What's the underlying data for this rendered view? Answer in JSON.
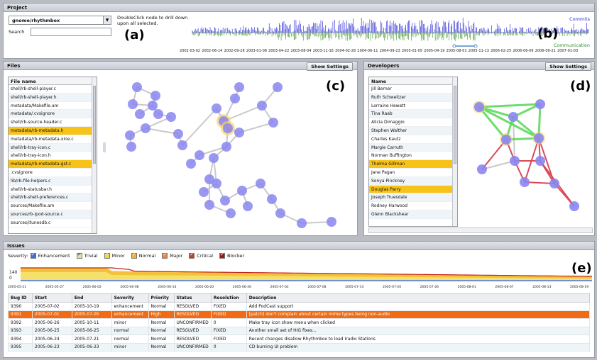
{
  "project": {
    "title": "Project",
    "repo": "gnome/rhythmbox",
    "search_label": "Search",
    "search_value": "",
    "hint": "DoubleClick node to drill down upon all selected.",
    "legend_commits": "Commits",
    "legend_communication": "Communication",
    "label": "(b)",
    "panel_label": "(a)",
    "ticks": [
      "2002-03-02",
      "2002-06-14",
      "2002-09-28",
      "2003-01-08",
      "2003-04-22",
      "2003-08-04",
      "2003-11-16",
      "2004-02-28",
      "2004-06-11",
      "2004-09-23",
      "2005-01-05",
      "2005-04-19",
      "2005-08-01",
      "2005-11-13",
      "2006-02-25",
      "2006-06-09",
      "2006-09-21",
      "2007-01-03"
    ],
    "colors": {
      "commits": "#3b3bdc",
      "communication": "#4f9d3a"
    }
  },
  "files": {
    "title": "Files",
    "settings_label": "Show Settings",
    "column": "File name",
    "label": "(c)",
    "items": [
      {
        "name": "shell/rb-shell-player.c",
        "selected": false
      },
      {
        "name": "shell/rb-shell-player.h",
        "selected": false
      },
      {
        "name": "metadata/Makefile.am",
        "selected": false
      },
      {
        "name": "metadata/.cvsignore",
        "selected": false
      },
      {
        "name": "shell/rb-source-header.c",
        "selected": false
      },
      {
        "name": "metadata/rb-metadata.h",
        "selected": true
      },
      {
        "name": "metadata/rb-metadata-xine.c",
        "selected": false
      },
      {
        "name": "shell/rb-tray-icon.c",
        "selected": false
      },
      {
        "name": "shell/rb-tray-icon.h",
        "selected": false
      },
      {
        "name": "metadata/rb-metadata-gst.c",
        "selected": true
      },
      {
        "name": ".cvsignore",
        "selected": false
      },
      {
        "name": "lib/rb-file-helpers.c",
        "selected": false
      },
      {
        "name": "shell/rb-statusbar.h",
        "selected": false
      },
      {
        "name": "shell/rb-shell-preferences.c",
        "selected": false
      },
      {
        "name": "sources/Makefile.am",
        "selected": false
      },
      {
        "name": "sources/rb-ipod-source.c",
        "selected": false
      },
      {
        "name": "sources/itunesdb.c",
        "selected": false
      }
    ]
  },
  "developers": {
    "title": "Developers",
    "settings_label": "Show Settings",
    "column": "Name",
    "label": "(d)",
    "items": [
      {
        "name": "Jill Berner",
        "selected": false
      },
      {
        "name": "Ruth Schweitzer",
        "selected": false
      },
      {
        "name": "Lorraine Hewett",
        "selected": false
      },
      {
        "name": "Tina Raab",
        "selected": false
      },
      {
        "name": "Alicia Dimaggio",
        "selected": false
      },
      {
        "name": "Stephen Walther",
        "selected": false
      },
      {
        "name": "Charles Kautz",
        "selected": false
      },
      {
        "name": "Margie Carruth",
        "selected": false
      },
      {
        "name": "Norman Buffington",
        "selected": false
      },
      {
        "name": "Thelma Gillman",
        "selected": true
      },
      {
        "name": "Jane Pagan",
        "selected": false
      },
      {
        "name": "Sonya Pinckney",
        "selected": false
      },
      {
        "name": "Douglas Parry",
        "selected": true
      },
      {
        "name": "Joseph Truesdale",
        "selected": false
      },
      {
        "name": "Rodney Harwood",
        "selected": false
      },
      {
        "name": "Glenn Blackshear",
        "selected": false
      }
    ]
  },
  "issues": {
    "title": "Issues",
    "severity_label": "Severity:",
    "label": "(e)",
    "severities": [
      {
        "name": "Enhancement",
        "color": "#3a6fd8"
      },
      {
        "name": "Trivial",
        "color": "#d6e8a0"
      },
      {
        "name": "Minor",
        "color": "#f4d53a"
      },
      {
        "name": "Normal",
        "color": "#f0b23a"
      },
      {
        "name": "Major",
        "color": "#e8853a"
      },
      {
        "name": "Critical",
        "color": "#c83a2a"
      },
      {
        "name": "Blocker",
        "color": "#9a1a1a"
      }
    ],
    "y_ticks": [
      "140",
      "0"
    ],
    "x_ticks": [
      "2005-05-21",
      "2005-05-27",
      "2005-06-02",
      "2005-06-08",
      "2005-06-14",
      "2005-06-20",
      "2005-06-26",
      "2005-07-02",
      "2005-07-08",
      "2005-07-14",
      "2005-07-20",
      "2005-07-26",
      "2005-08-01",
      "2005-08-07",
      "2005-08-13",
      "2005-08-19"
    ],
    "columns": [
      "Bug ID",
      "Start",
      "End",
      "Severity",
      "Priority",
      "Status",
      "Resolution",
      "Description"
    ],
    "rows": [
      {
        "cells": [
          "9390",
          "2005-07-02",
          "2005-10-19",
          "enhancement",
          "Normal",
          "RESOLVED",
          "FIXED",
          "Add PodCast support"
        ],
        "highlight": false
      },
      {
        "cells": [
          "9391",
          "2005-07-01",
          "2005-07-05",
          "enhancement",
          "High",
          "RESOLVED",
          "FIXED",
          "[patch] don't complain about certain mime types being non-audio"
        ],
        "highlight": true
      },
      {
        "cells": [
          "9392",
          "2005-06-26",
          "2005-10-11",
          "minor",
          "Normal",
          "UNCONFIRMED",
          "0",
          "Make tray icon show menu when clicked"
        ],
        "highlight": false
      },
      {
        "cells": [
          "9393",
          "2005-06-25",
          "2005-06-25",
          "normal",
          "Normal",
          "RESOLVED",
          "FIXED",
          "Another small set of HIG fixes..."
        ],
        "highlight": false
      },
      {
        "cells": [
          "9394",
          "2005-06-24",
          "2005-07-21",
          "normal",
          "Normal",
          "RESOLVED",
          "FIXED",
          "Recent changes disallow Rhythmbox to load Iradio Stations"
        ],
        "highlight": false
      },
      {
        "cells": [
          "9395",
          "2005-06-23",
          "2005-06-23",
          "minor",
          "Normal",
          "UNCONFIRMED",
          "0",
          "CD burning UI problem"
        ],
        "highlight": false
      }
    ]
  }
}
